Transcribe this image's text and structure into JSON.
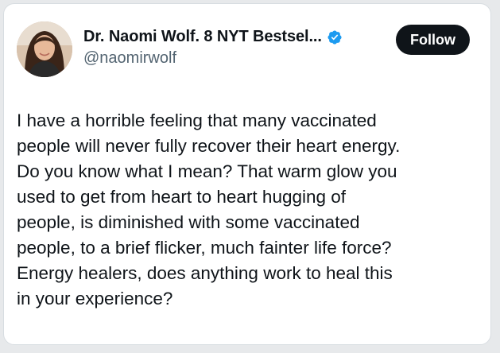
{
  "author": {
    "display_name": "Dr. Naomi Wolf. 8 NYT Bestsel...",
    "handle": "@naomirwolf",
    "verified_icon": "verified-badge-icon",
    "avatar_icon": "profile-photo"
  },
  "actions": {
    "follow_label": "Follow"
  },
  "tweet": {
    "text": "I have a horrible feeling that many vaccinated\npeople will never fully recover their heart energy.\nDo you know what I mean? That warm glow you\nused to get from heart to heart hugging of\npeople, is diminished with some vaccinated\npeople, to a brief flicker, much fainter life force?\nEnergy healers, does anything work to heal this\nin your experience?"
  },
  "colors": {
    "text_primary": "#0f1419",
    "text_secondary": "#536471",
    "verified_blue": "#1d9bf0",
    "button_bg": "#0f1419",
    "button_text": "#ffffff"
  }
}
